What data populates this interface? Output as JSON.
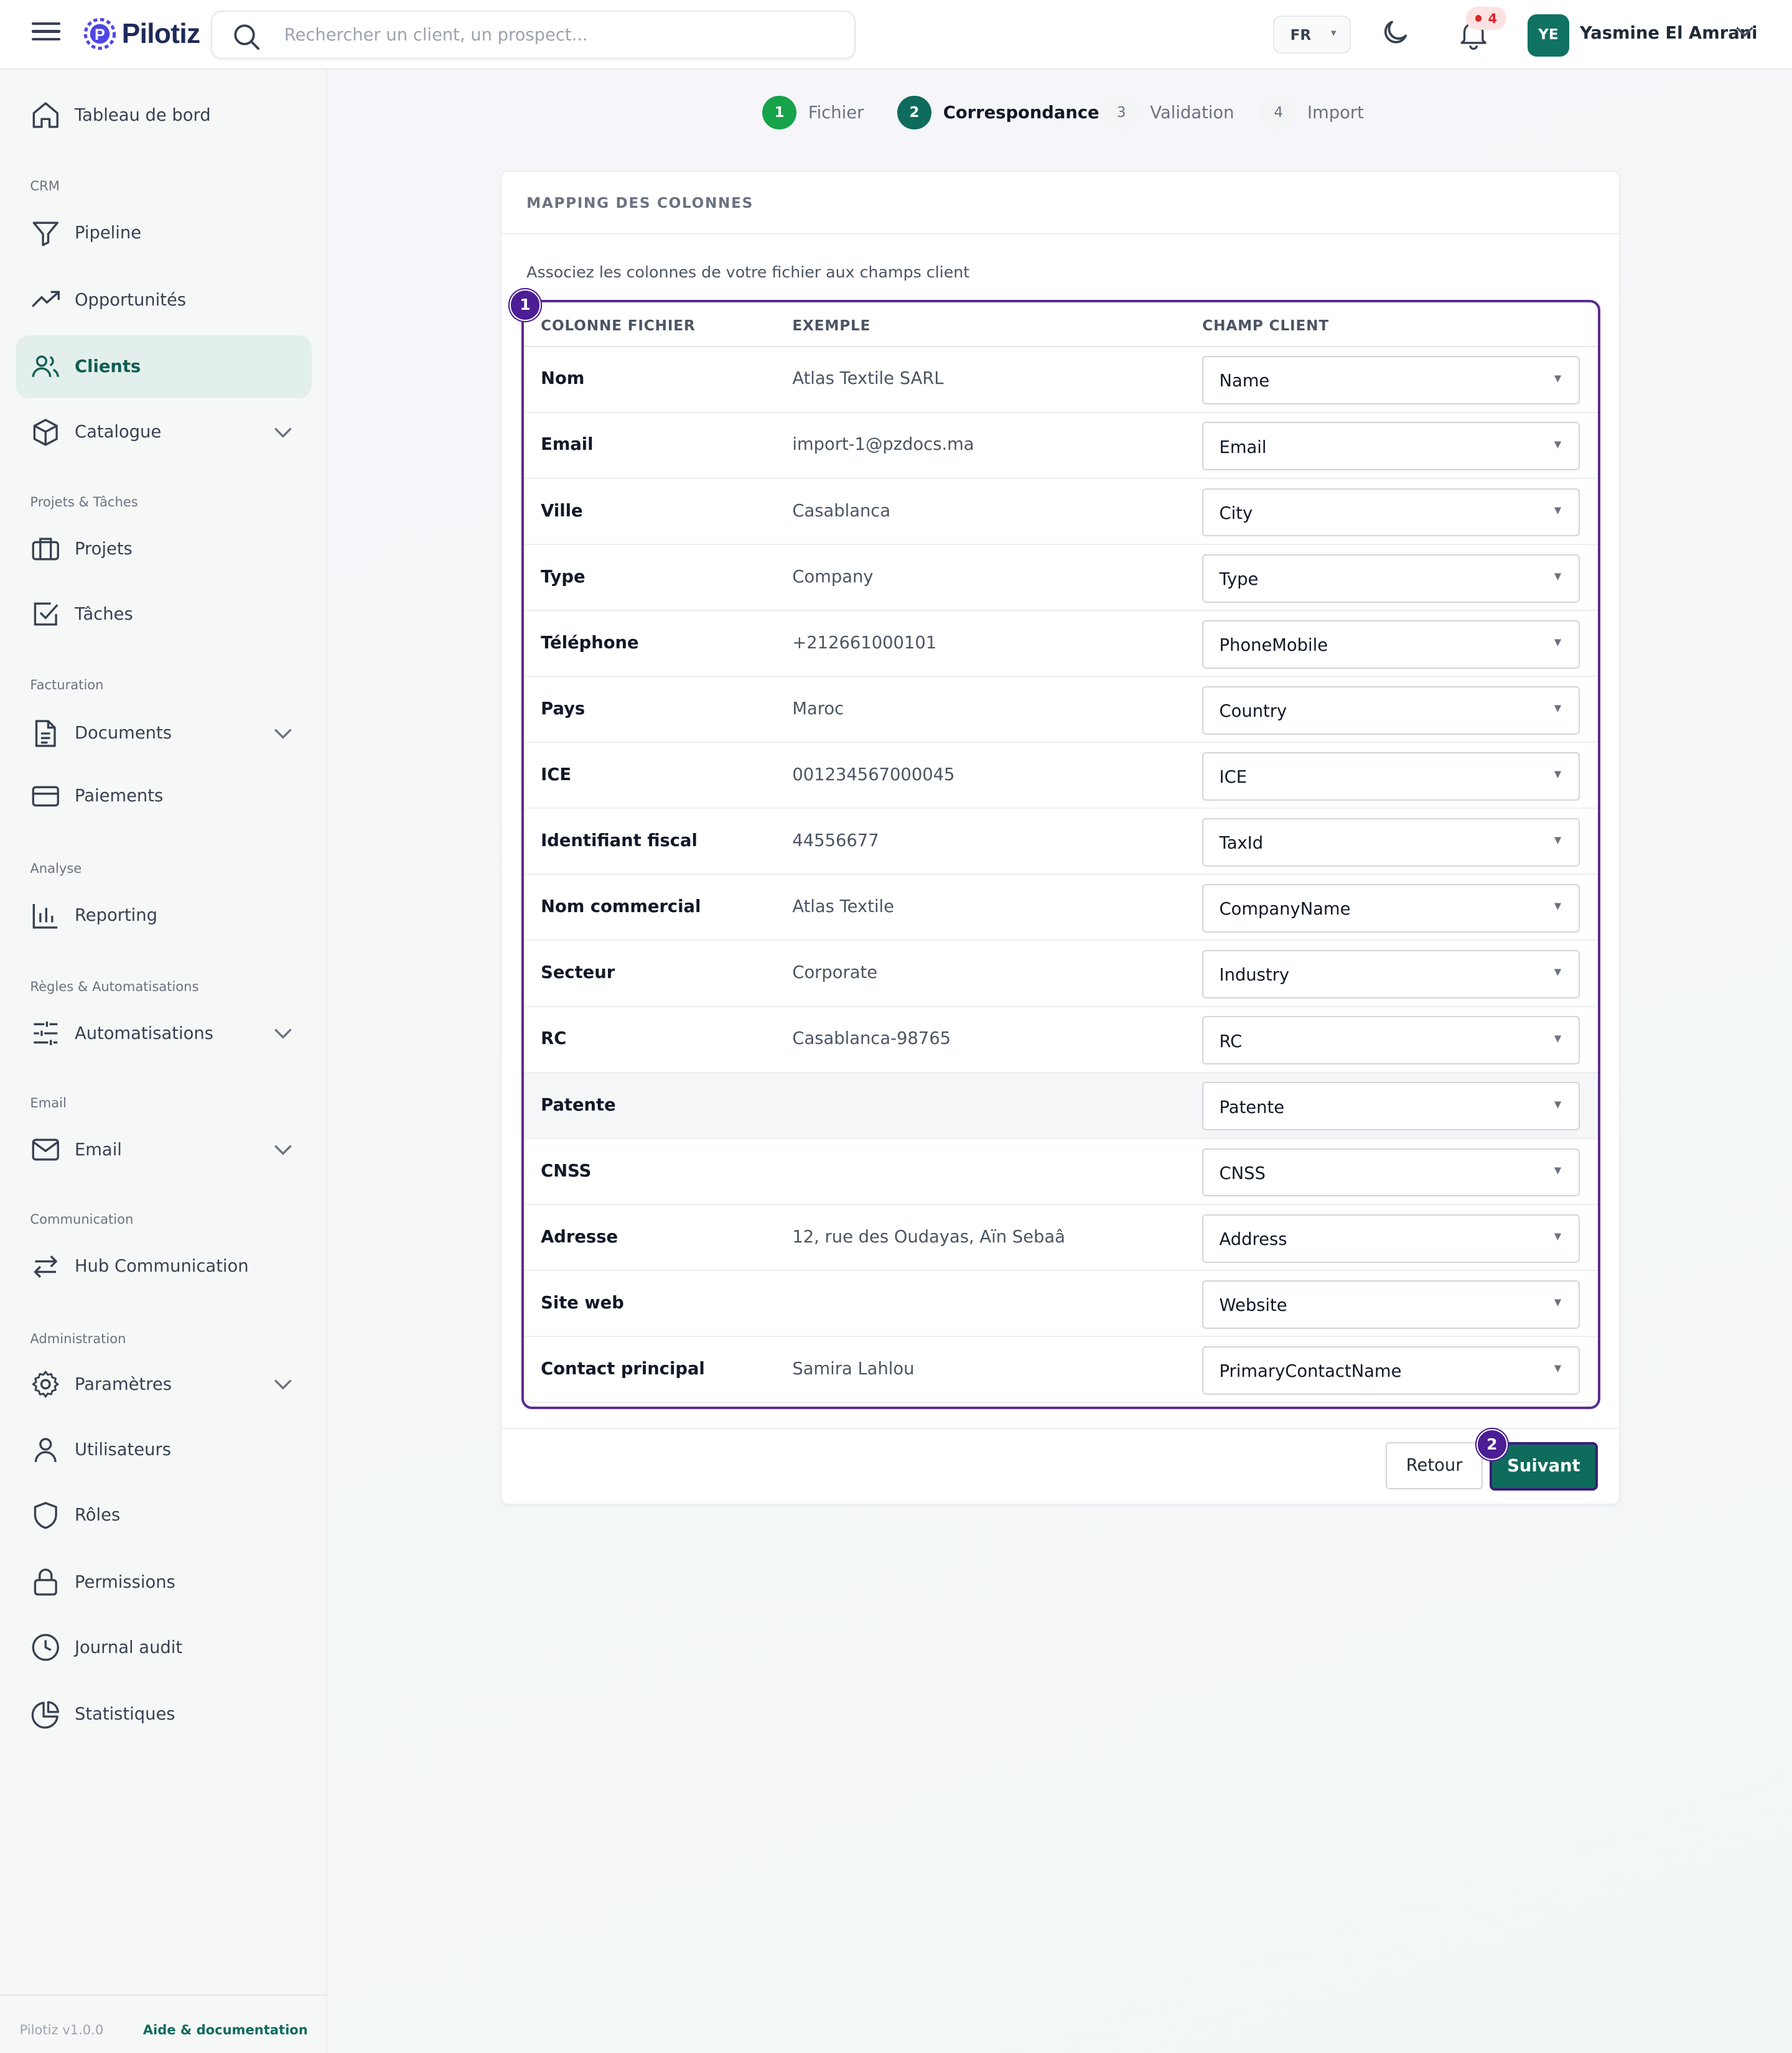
{
  "header": {
    "brand": "Pilotiz",
    "search_placeholder": "Rechercher un client, un prospect...",
    "language": "FR",
    "notifications_count": "4",
    "user_initials": "YE",
    "user_name": "Yasmine El Amrani"
  },
  "sidebar": {
    "dashboard": "Tableau de bord",
    "sections": {
      "crm": "CRM",
      "projects": "Projets & Tâches",
      "billing": "Facturation",
      "analysis": "Analyse",
      "rules": "Règles & Automatisations",
      "email": "Email",
      "communication": "Communication",
      "admin": "Administration"
    },
    "items": {
      "pipeline": "Pipeline",
      "opportunities": "Opportunités",
      "clients": "Clients",
      "catalogue": "Catalogue",
      "projects": "Projets",
      "tasks": "Tâches",
      "documents": "Documents",
      "payments": "Paiements",
      "reporting": "Reporting",
      "automations": "Automatisations",
      "email": "Email",
      "hub": "Hub Communication",
      "settings": "Paramètres",
      "users": "Utilisateurs",
      "roles": "Rôles",
      "permissions": "Permissions",
      "audit": "Journal audit",
      "stats": "Statistiques"
    },
    "version": "Pilotiz v1.0.0",
    "help": "Aide & documentation"
  },
  "stepper": [
    {
      "num": "1",
      "label": "Fichier"
    },
    {
      "num": "2",
      "label": "Correspondance"
    },
    {
      "num": "3",
      "label": "Validation"
    },
    {
      "num": "4",
      "label": "Import"
    }
  ],
  "card": {
    "title": "MAPPING DES COLONNES",
    "description": "Associez les colonnes de votre fichier aux champs client",
    "marker_table": "1",
    "marker_next": "2",
    "columns": [
      "COLONNE FICHIER",
      "EXEMPLE",
      "CHAMP CLIENT"
    ],
    "rows": [
      {
        "column": "Nom",
        "example": "Atlas Textile SARL",
        "field": "Name"
      },
      {
        "column": "Email",
        "example": "import-1@pzdocs.ma",
        "field": "Email"
      },
      {
        "column": "Ville",
        "example": "Casablanca",
        "field": "City"
      },
      {
        "column": "Type",
        "example": "Company",
        "field": "Type"
      },
      {
        "column": "Téléphone",
        "example": "+212661000101",
        "field": "PhoneMobile"
      },
      {
        "column": "Pays",
        "example": "Maroc",
        "field": "Country"
      },
      {
        "column": "ICE",
        "example": "001234567000045",
        "field": "ICE"
      },
      {
        "column": "Identifiant fiscal",
        "example": "44556677",
        "field": "TaxId"
      },
      {
        "column": "Nom commercial",
        "example": "Atlas Textile",
        "field": "CompanyName"
      },
      {
        "column": "Secteur",
        "example": "Corporate",
        "field": "Industry"
      },
      {
        "column": "RC",
        "example": "Casablanca-98765",
        "field": "RC"
      },
      {
        "column": "Patente",
        "example": "",
        "field": "Patente"
      },
      {
        "column": "CNSS",
        "example": "",
        "field": "CNSS"
      },
      {
        "column": "Adresse",
        "example": "12, rue des Oudayas, Aïn Sebaâ",
        "field": "Address"
      },
      {
        "column": "Site web",
        "example": "",
        "field": "Website"
      },
      {
        "column": "Contact principal",
        "example": "Samira Lahlou",
        "field": "PrimaryContactName"
      }
    ],
    "back_label": "Retour",
    "next_label": "Suivant"
  }
}
